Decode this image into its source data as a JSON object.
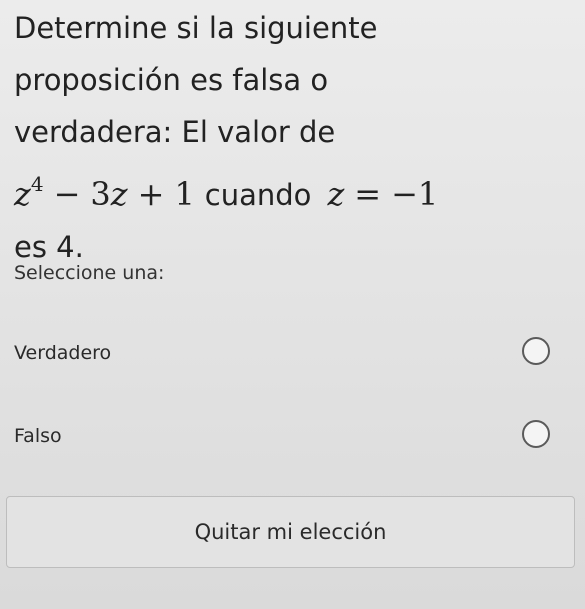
{
  "question": {
    "line1": "Determine si la siguiente",
    "line2": "proposición es falsa o",
    "line3": "verdadera: El valor de",
    "expr_base": "z",
    "expr_exp": "4",
    "expr_minus": "−",
    "expr_coef": "3",
    "expr_var": "z",
    "expr_plus": "+",
    "expr_const": "1",
    "when_word": "cuando",
    "cond_var": "z",
    "cond_eq": "=",
    "cond_value": "−1",
    "line5": "es 4."
  },
  "prompt": "Seleccione una:",
  "options": [
    {
      "label": "Verdadero",
      "selected": false
    },
    {
      "label": "Falso",
      "selected": false
    }
  ],
  "clear_button_label": "Quitar mi elección"
}
